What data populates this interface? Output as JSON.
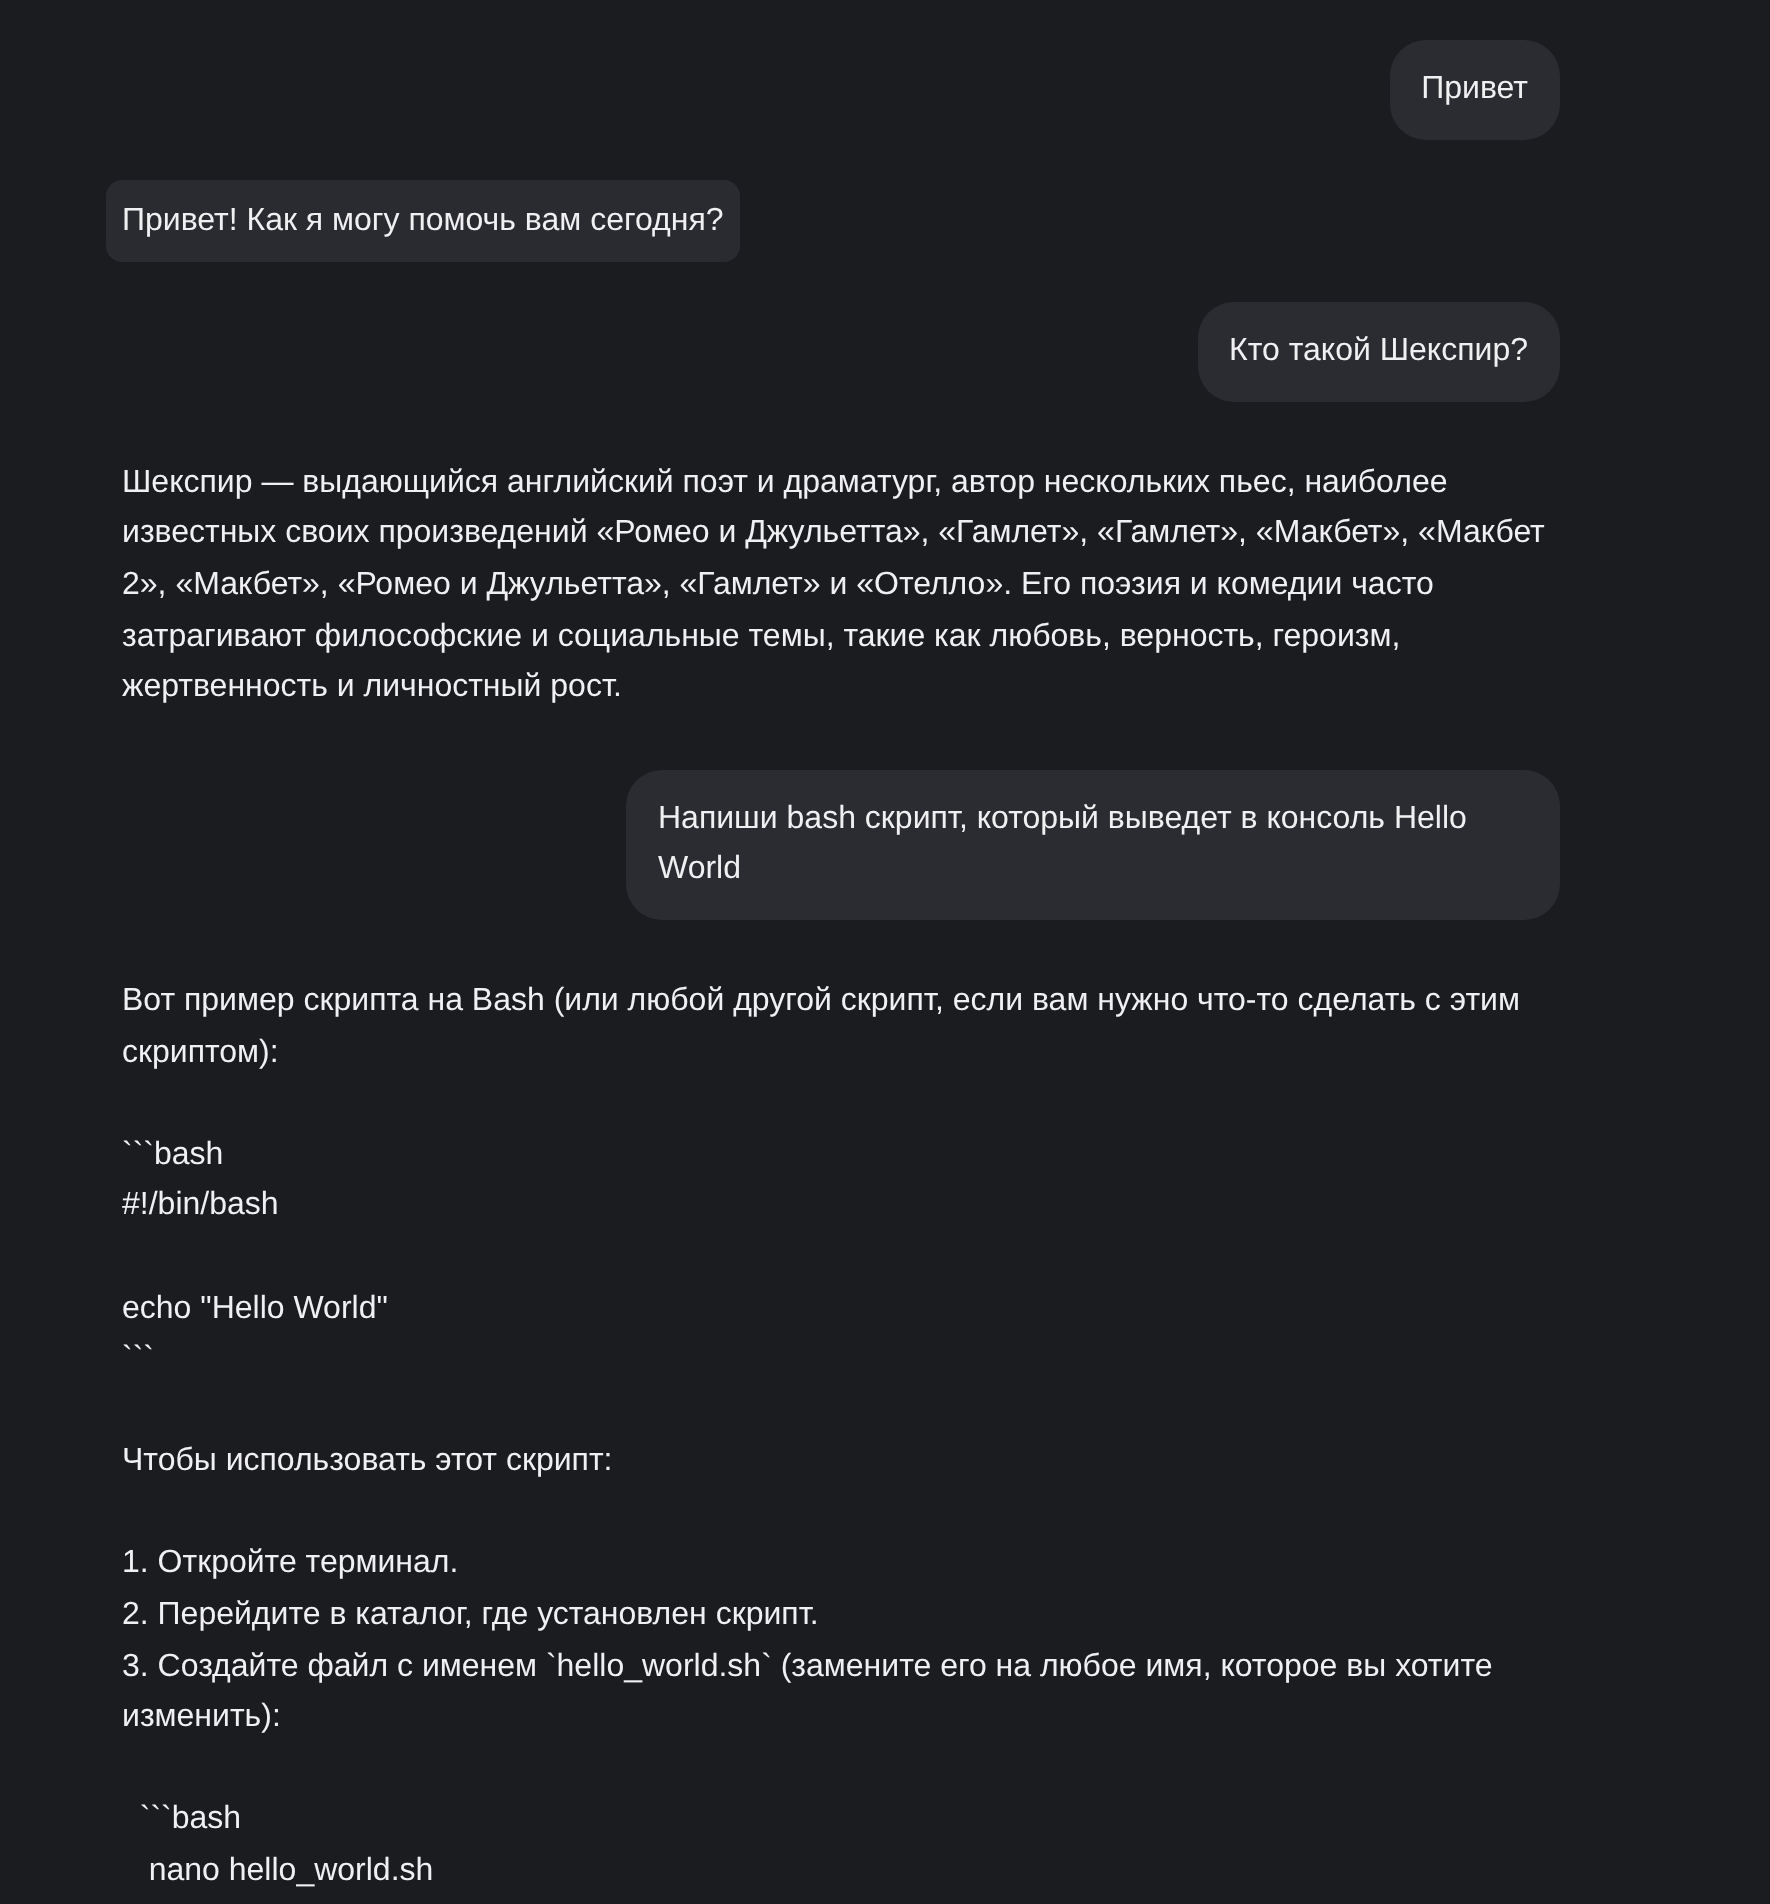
{
  "messages": [
    {
      "kind": "user",
      "text": "Привет"
    },
    {
      "kind": "assistant",
      "highlighted": true,
      "paragraphs": [
        "Привет! Как я могу помочь вам сегодня?"
      ]
    },
    {
      "kind": "user",
      "text": "Кто такой Шекспир?"
    },
    {
      "kind": "assistant",
      "highlighted": false,
      "paragraphs": [
        "Шекспир — выдающийся английский поэт и драматург, автор нескольких пьес, наиболее известных своих произведений «Ромео и Джульетта», «Гамлет», «Гамлет», «Макбет», «Макбет 2», «Макбет», «Ромео и Джульетта», «Гамлет» и «Отелло». Его поэзия и комедии часто затрагивают философские и социальные темы, такие как любовь, верность, героизм, жертвенность и личностный рост."
      ]
    },
    {
      "kind": "user",
      "text": "Напиши bash скрипт, который выведет в консоль Hello World"
    },
    {
      "kind": "assistant",
      "highlighted": false,
      "paragraphs": [
        "Вот пример скрипта на Bash (или любой другой скрипт, если вам нужно что-то сделать с этим скриптом):",
        "```bash\n#!/bin/bash",
        "echo \"Hello World\"\n```",
        "Чтобы использовать этот скрипт:",
        "1. Откройте терминал.\n2. Перейдите в каталог, где установлен скрипт.\n3. Создайте файл с именем `hello_world.sh` (замените его на любое имя, которое вы хотите изменить):",
        "  ```bash\n   nano hello_world.sh"
      ]
    }
  ]
}
